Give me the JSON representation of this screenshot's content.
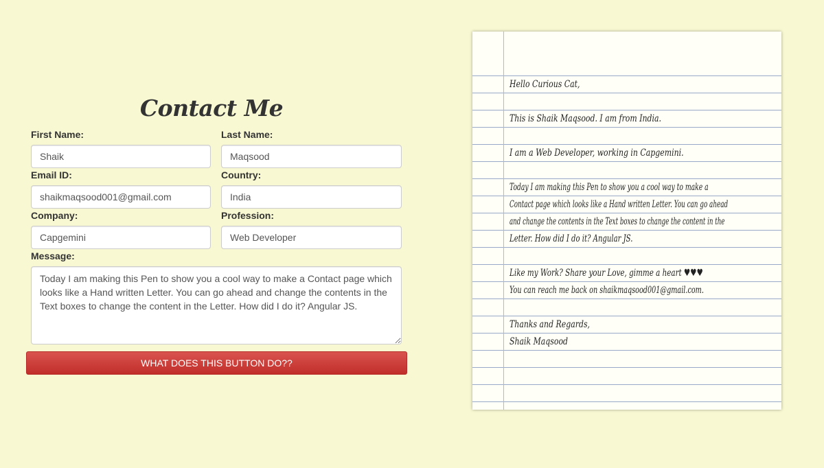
{
  "form": {
    "title": "Contact Me",
    "first_name_label": "First Name:",
    "first_name_value": "Shaik",
    "last_name_label": "Last Name:",
    "last_name_value": "Maqsood",
    "email_label": "Email ID:",
    "email_value": "shaikmaqsood001@gmail.com",
    "country_label": "Country:",
    "country_value": "India",
    "company_label": "Company:",
    "company_value": "Capgemini",
    "profession_label": "Profession:",
    "profession_value": "Web Developer",
    "message_label": "Message:",
    "message_value": "Today I am making this Pen to show you a cool way to make a Contact page which looks like a Hand written Letter. You can go ahead and change the contents in the Text boxes to change the content in the Letter. How did I do it? Angular JS.",
    "button_label": "WHAT DOES THIS BUTTON DO??"
  },
  "letter": {
    "greeting": "Hello Curious Cat,",
    "intro": "This is Shaik Maqsood. I am from India.",
    "job": "I am a Web Developer, working in Capgemini.",
    "message_lines": [
      "Today I am making this Pen to show you a cool way to make a",
      "Contact page which looks like a Hand written Letter. You can go ahead",
      "and change the contents in the Text boxes to change the content in the",
      "Letter. How did I do it? Angular JS."
    ],
    "like": "Like my Work? Share your Love, gimme a heart ♥♥♥",
    "reach": "You can reach me back on shaikmaqsood001@gmail.com.",
    "thanks": "Thanks and Regards,",
    "signature": "Shaik Maqsood"
  },
  "colors": {
    "background": "#f8f8d2",
    "button": "#d9534f",
    "paper": "#fffff7",
    "rule_line": "#97a8c8",
    "margin_line": "#e8a3a8"
  }
}
